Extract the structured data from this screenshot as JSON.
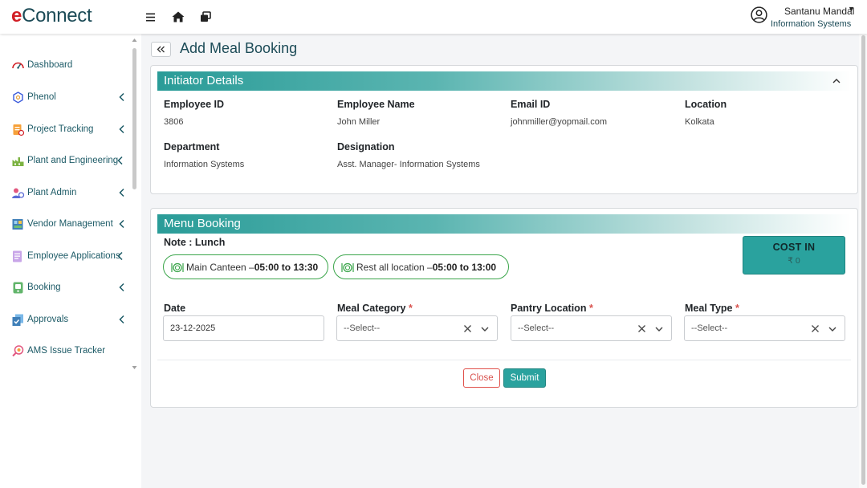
{
  "app": {
    "logo_e": "e",
    "logo_rest": "Connect"
  },
  "topbar": {
    "menu_icon": "hamburger-icon",
    "home_icon": "home-icon",
    "windows_icon": "window-stack-icon",
    "user_name": "Santanu Mandal",
    "user_department": "Information Systems"
  },
  "sidebar": {
    "items": [
      {
        "label": "Dashboard",
        "icon": "dashboard-gauge-icon",
        "has_chevron": false
      },
      {
        "label": "Phenol",
        "icon": "phenol-molecule-icon",
        "has_chevron": true
      },
      {
        "label": "Project Tracking",
        "icon": "project-tracking-icon",
        "has_chevron": true
      },
      {
        "label": "Plant and Engineering",
        "icon": "plant-engineering-icon",
        "has_chevron": true
      },
      {
        "label": "Plant Admin",
        "icon": "plant-admin-icon",
        "has_chevron": true
      },
      {
        "label": "Vendor Management",
        "icon": "vendor-management-icon",
        "has_chevron": true
      },
      {
        "label": "Employee Applications",
        "icon": "employee-applications-icon",
        "has_chevron": true
      },
      {
        "label": "Booking",
        "icon": "booking-icon",
        "has_chevron": true
      },
      {
        "label": "Approvals",
        "icon": "approvals-icon",
        "has_chevron": true
      },
      {
        "label": "AMS Issue Tracker",
        "icon": "issue-tracker-icon",
        "has_chevron": false
      }
    ]
  },
  "page": {
    "title": "Add Meal Booking"
  },
  "initiator": {
    "section_title": "Initiator Details",
    "employee_id_label": "Employee ID",
    "employee_id": "3806",
    "employee_name_label": "Employee Name",
    "employee_name": "John Miller",
    "email_label": "Email ID",
    "email": "johnmiller@yopmail.com",
    "location_label": "Location",
    "location": "Kolkata",
    "department_label": "Department",
    "department": "Information Systems",
    "designation_label": "Designation",
    "designation": "Asst. Manager- Information Systems"
  },
  "menu": {
    "section_title": "Menu Booking",
    "note": "Note : Lunch",
    "pills": [
      {
        "place": "Main Canteen – ",
        "time": "05:00 to 13:30"
      },
      {
        "place": "Rest all location – ",
        "time": "05:00 to 13:00"
      }
    ],
    "cost_title": "COST IN",
    "cost_value": "₹ 0",
    "date_label": "Date",
    "date_value": "23-12-2025",
    "meal_category_label": "Meal Category",
    "pantry_location_label": "Pantry Location",
    "meal_type_label": "Meal Type",
    "required_mark": "*",
    "select_placeholder": "--Select--",
    "close_label": "Close",
    "submit_label": "Submit"
  },
  "colors": {
    "brand_red": "#d11f26",
    "brand_teal": "#2aa29e",
    "text_teal": "#1c4b57",
    "pill_green": "#3aa54a",
    "danger": "#d9534f"
  }
}
